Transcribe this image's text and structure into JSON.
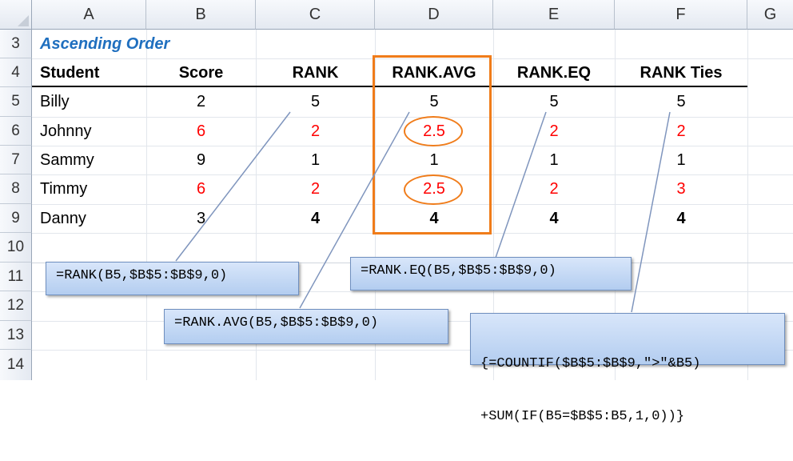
{
  "columns": [
    "A",
    "B",
    "C",
    "D",
    "E",
    "F",
    "G"
  ],
  "rows": [
    "3",
    "4",
    "5",
    "6",
    "7",
    "8",
    "9",
    "10",
    "11",
    "12",
    "13",
    "14"
  ],
  "section_title": "Ascending Order",
  "headers": {
    "student": "Student",
    "score": "Score",
    "rank": "RANK",
    "rank_avg": "RANK.AVG",
    "rank_eq": "RANK.EQ",
    "rank_ties": "RANK Ties"
  },
  "data_rows": [
    {
      "student": "Billy",
      "score": "2",
      "rank": "5",
      "rank_avg": "5",
      "rank_eq": "5",
      "rank_ties": "5"
    },
    {
      "student": "Johnny",
      "score": "6",
      "rank": "2",
      "rank_avg": "2.5",
      "rank_eq": "2",
      "rank_ties": "2"
    },
    {
      "student": "Sammy",
      "score": "9",
      "rank": "1",
      "rank_avg": "1",
      "rank_eq": "1",
      "rank_ties": "1"
    },
    {
      "student": "Timmy",
      "score": "6",
      "rank": "2",
      "rank_avg": "2.5",
      "rank_eq": "2",
      "rank_ties": "3"
    },
    {
      "student": "Danny",
      "score": "3",
      "rank": "4",
      "rank_avg": "4",
      "rank_eq": "4",
      "rank_ties": "4"
    }
  ],
  "formulas": {
    "rank": "=RANK(B5,$B$5:$B$9,0)",
    "rank_avg": "=RANK.AVG(B5,$B$5:$B$9,0)",
    "rank_eq": "=RANK.EQ(B5,$B$5:$B$9,0)",
    "rank_ties_line1": "{=COUNTIF($B$5:$B$9,\">\"&B5)",
    "rank_ties_line2": "+SUM(IF(B5=$B$5:B5,1,0))}"
  },
  "colors": {
    "title": "#1f6fbf",
    "tie_value": "#ff0000",
    "highlight": "#f07c1a",
    "callout_fill": "#b3cdf0"
  }
}
